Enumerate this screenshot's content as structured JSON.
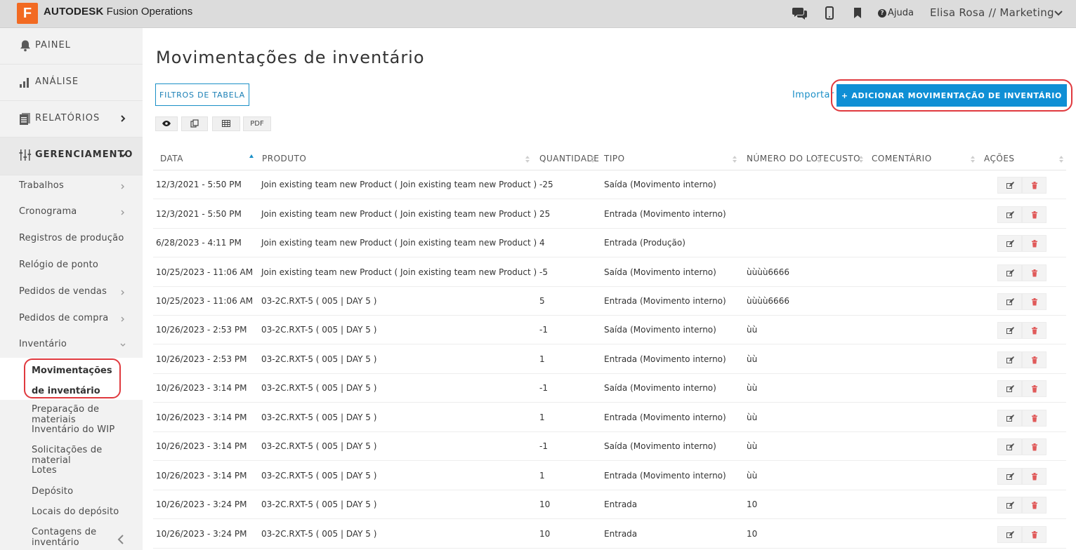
{
  "app": {
    "logo_letter": "F",
    "brand_bold": "AUTODESK",
    "brand_rest": " Fusion Operations",
    "help_label": "Ajuda",
    "user": "Elisa Rosa // Marketing"
  },
  "sidebar": {
    "main": [
      {
        "label": "PAINEL"
      },
      {
        "label": "ANÁLISE"
      },
      {
        "label": "RELATÓRIOS"
      },
      {
        "label": "GERENCIAMENTO"
      }
    ],
    "sub": [
      {
        "label": "Trabalhos"
      },
      {
        "label": "Cronograma"
      },
      {
        "label": "Registros de produção"
      },
      {
        "label": "Relógio de ponto"
      },
      {
        "label": "Pedidos de vendas"
      },
      {
        "label": "Pedidos de compra"
      },
      {
        "label": "Inventário"
      }
    ],
    "inventory_items": [
      {
        "label": "Movimentações de inventário"
      },
      {
        "label": "Preparação de materiais"
      },
      {
        "label": "Inventário do WIP"
      },
      {
        "label": "Solicitações de material"
      },
      {
        "label": "Lotes"
      },
      {
        "label": "Depósito"
      },
      {
        "label": "Locais do depósito"
      },
      {
        "label": "Contagens de inventário"
      }
    ]
  },
  "main": {
    "title": "Movimentações de inventário",
    "filters_button": "FILTROS DE TABELA",
    "pdf_button": "PDF",
    "import_link": "Importar",
    "add_button": "+ ADICIONAR MOVIMENTAÇÃO DE INVENTÁRIO"
  },
  "table": {
    "columns": [
      "DATA",
      "PRODUTO",
      "QUANTIDADE",
      "TIPO",
      "NÚMERO DO LOTE",
      "CUSTO",
      "COMENTÁRIO",
      "AÇÕES"
    ],
    "rows": [
      {
        "date": "12/3/2021 - 5:50 PM",
        "product": "Join existing team new Product ( Join existing team new Product )",
        "qty": "-25",
        "type": "Saída (Movimento interno)",
        "lot": ""
      },
      {
        "date": "12/3/2021 - 5:50 PM",
        "product": "Join existing team new Product ( Join existing team new Product )",
        "qty": "25",
        "type": "Entrada (Movimento interno)",
        "lot": ""
      },
      {
        "date": "6/28/2023 - 4:11 PM",
        "product": "Join existing team new Product ( Join existing team new Product )",
        "qty": "4",
        "type": "Entrada (Produção)",
        "lot": ""
      },
      {
        "date": "10/25/2023 - 11:06 AM",
        "product": "Join existing team new Product ( Join existing team new Product )",
        "qty": "-5",
        "type": "Saída (Movimento interno)",
        "lot": "ùùùù6666"
      },
      {
        "date": "10/25/2023 - 11:06 AM",
        "product": "03-2C.RXT-5 ( 005 | DAY 5 )",
        "qty": "5",
        "type": "Entrada (Movimento interno)",
        "lot": "ùùùù6666"
      },
      {
        "date": "10/26/2023 - 2:53 PM",
        "product": "03-2C.RXT-5 ( 005 | DAY 5 )",
        "qty": "-1",
        "type": "Saída (Movimento interno)",
        "lot": "ùù"
      },
      {
        "date": "10/26/2023 - 2:53 PM",
        "product": "03-2C.RXT-5 ( 005 | DAY 5 )",
        "qty": "1",
        "type": "Entrada (Movimento interno)",
        "lot": "ùù"
      },
      {
        "date": "10/26/2023 - 3:14 PM",
        "product": "03-2C.RXT-5 ( 005 | DAY 5 )",
        "qty": "-1",
        "type": "Saída (Movimento interno)",
        "lot": "ùù"
      },
      {
        "date": "10/26/2023 - 3:14 PM",
        "product": "03-2C.RXT-5 ( 005 | DAY 5 )",
        "qty": "1",
        "type": "Entrada (Movimento interno)",
        "lot": "ùù"
      },
      {
        "date": "10/26/2023 - 3:14 PM",
        "product": "03-2C.RXT-5 ( 005 | DAY 5 )",
        "qty": "-1",
        "type": "Saída (Movimento interno)",
        "lot": "ùù"
      },
      {
        "date": "10/26/2023 - 3:14 PM",
        "product": "03-2C.RXT-5 ( 005 | DAY 5 )",
        "qty": "1",
        "type": "Entrada (Movimento interno)",
        "lot": "ùù"
      },
      {
        "date": "10/26/2023 - 3:24 PM",
        "product": "03-2C.RXT-5 ( 005 | DAY 5 )",
        "qty": "10",
        "type": "Entrada",
        "lot": "10"
      },
      {
        "date": "10/26/2023 - 3:24 PM",
        "product": "03-2C.RXT-5 ( 005 | DAY 5 )",
        "qty": "10",
        "type": "Entrada",
        "lot": "10"
      }
    ]
  },
  "colors": {
    "accent": "#0f8fd5",
    "highlight_ring": "#e0393e",
    "delete_icon": "#e05a5a",
    "logo": "#f26a22"
  }
}
